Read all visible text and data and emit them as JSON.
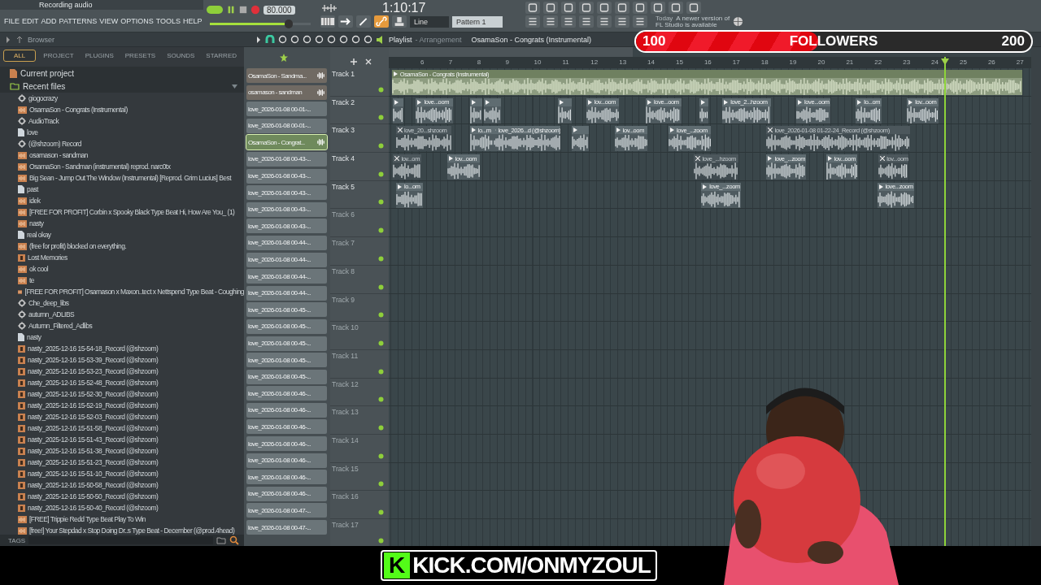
{
  "top_bar": {
    "hint": "Recording audio",
    "menu": [
      "FILE",
      "EDIT",
      "ADD",
      "PATTERNS",
      "VIEW",
      "OPTIONS",
      "TOOLS",
      "HELP"
    ],
    "tempo": "80.000",
    "time": "1:10:17",
    "master_volume": {
      "level": 0.78
    },
    "snap": "Line",
    "pattern": "Pattern 1",
    "news": {
      "date": "Today",
      "lines": [
        "A newer version of",
        "FL Studio is available"
      ]
    }
  },
  "browser": {
    "title": "Browser",
    "tabs": [
      {
        "label": "ALL",
        "selected": true
      },
      {
        "label": "PROJECT",
        "selected": false
      },
      {
        "label": "PLUGINS",
        "selected": false
      },
      {
        "label": "PRESETS",
        "selected": false
      },
      {
        "label": "SOUNDS",
        "selected": false
      },
      {
        "label": "STARRED",
        "selected": false
      }
    ],
    "tree": [
      {
        "label": "Current project",
        "kind": "project",
        "expanded": false
      },
      {
        "label": "Recent files",
        "kind": "recent",
        "expanded": true,
        "children": [
          {
            "label": "giogocrazy",
            "kind": "plugin"
          },
          {
            "label": "OsamaSon - Congrats (Instrumental)",
            "kind": "audio"
          },
          {
            "label": "AudioTrack",
            "kind": "plugin"
          },
          {
            "label": "love",
            "kind": "file"
          },
          {
            "label": "(@shzoom) Record",
            "kind": "plugin"
          },
          {
            "label": "osamason - sandman",
            "kind": "audio"
          },
          {
            "label": "OsamaSon - Sandman (instrumental) reprod. narc0tx",
            "kind": "audio"
          },
          {
            "label": "Big Sean - Jump Out The Window (Instrumental) [Reprod. Grim Lucius] Best",
            "kind": "audio"
          },
          {
            "label": "past",
            "kind": "file"
          },
          {
            "label": "idek",
            "kind": "audio"
          },
          {
            "label": "[FREE FOR PROFIT] Corbin x Spooky Black Type Beat Hi, How Are You_ (1)",
            "kind": "audio"
          },
          {
            "label": "nasty",
            "kind": "audio"
          },
          {
            "label": "real okay",
            "kind": "file"
          },
          {
            "label": "(free for profit) blocked on everything.",
            "kind": "audio"
          },
          {
            "label": "Lost Memories",
            "kind": "recording"
          },
          {
            "label": "ok cool",
            "kind": "audio"
          },
          {
            "label": "te",
            "kind": "audio"
          },
          {
            "label": "[FREE FOR PROFIT] Osamason x Maxon..tect x Nettspend Type Beat - Coughing",
            "kind": "audio"
          },
          {
            "label": "Che_deep_libs",
            "kind": "plugin"
          },
          {
            "label": "autumn_ADLIBS",
            "kind": "plugin"
          },
          {
            "label": "Autumn_Filtered_Adlibs",
            "kind": "plugin"
          },
          {
            "label": "nasty",
            "kind": "file"
          },
          {
            "label": "nasty_2025-12-16 15-54-18_Record (@shzoom)",
            "kind": "recording"
          },
          {
            "label": "nasty_2025-12-16 15-53-39_Record (@shzoom)",
            "kind": "recording"
          },
          {
            "label": "nasty_2025-12-16 15-53-23_Record (@shzoom)",
            "kind": "recording"
          },
          {
            "label": "nasty_2025-12-16 15-52-48_Record (@shzoom)",
            "kind": "recording"
          },
          {
            "label": "nasty_2025-12-16 15-52-30_Record (@shzoom)",
            "kind": "recording"
          },
          {
            "label": "nasty_2025-12-16 15-52-19_Record (@shzoom)",
            "kind": "recording"
          },
          {
            "label": "nasty_2025-12-16 15-52-03_Record (@shzoom)",
            "kind": "recording"
          },
          {
            "label": "nasty_2025-12-16 15-51-58_Record (@shzoom)",
            "kind": "recording"
          },
          {
            "label": "nasty_2025-12-16 15-51-43_Record (@shzoom)",
            "kind": "recording"
          },
          {
            "label": "nasty_2025-12-16 15-51-38_Record (@shzoom)",
            "kind": "recording"
          },
          {
            "label": "nasty_2025-12-16 15-51-23_Record (@shzoom)",
            "kind": "recording"
          },
          {
            "label": "nasty_2025-12-16 15-51-10_Record (@shzoom)",
            "kind": "recording"
          },
          {
            "label": "nasty_2025-12-16 15-50-58_Record (@shzoom)",
            "kind": "recording"
          },
          {
            "label": "nasty_2025-12-16 15-50-50_Record (@shzoom)",
            "kind": "recording"
          },
          {
            "label": "nasty_2025-12-16 15-50-40_Record (@shzoom)",
            "kind": "recording"
          },
          {
            "label": "[FREE] Trippie Redd Type Beat Play To Win",
            "kind": "audio"
          },
          {
            "label": "[free!] Your Stepdad x Stop Doing Dr..s Type Beat - December (@prod.4head)",
            "kind": "audio"
          }
        ]
      }
    ],
    "tags_label": "TAGS"
  },
  "playlist": {
    "title": "Playlist",
    "subtitle": "- Arrangement",
    "arrangement": "OsamaSon - Congrats (Instrumental)",
    "clip_list": [
      {
        "label": "OsamaSon - Sandma...",
        "kind": "audio",
        "selected": false
      },
      {
        "label": "osamason - sandman",
        "kind": "audio",
        "selected": false
      },
      {
        "label": "love_2026-01-08 00-01-...",
        "kind": "clip",
        "selected": false
      },
      {
        "label": "love_2026-01-08 00-01-...",
        "kind": "clip",
        "selected": false
      },
      {
        "label": "OsamaSon - Congrat...",
        "kind": "audio",
        "selected": true
      },
      {
        "label": "love_2026-01-08 00-43-...",
        "kind": "clip",
        "selected": false
      },
      {
        "label": "love_2026-01-08 00-43-...",
        "kind": "clip",
        "selected": false
      },
      {
        "label": "love_2026-01-08 00-43-...",
        "kind": "clip",
        "selected": false
      },
      {
        "label": "love_2026-01-08 00-43-...",
        "kind": "clip",
        "selected": false
      },
      {
        "label": "love_2026-01-08 00-43-...",
        "kind": "clip",
        "selected": false
      },
      {
        "label": "love_2026-01-08 00-44-...",
        "kind": "clip",
        "selected": false
      },
      {
        "label": "love_2026-01-08 00-44-...",
        "kind": "clip",
        "selected": false
      },
      {
        "label": "love_2026-01-08 00-44-...",
        "kind": "clip",
        "selected": false
      },
      {
        "label": "love_2026-01-08 00-44-...",
        "kind": "clip",
        "selected": false
      },
      {
        "label": "love_2026-01-08 00-45-...",
        "kind": "clip",
        "selected": false
      },
      {
        "label": "love_2026-01-08 00-45-...",
        "kind": "clip",
        "selected": false
      },
      {
        "label": "love_2026-01-08 00-45-...",
        "kind": "clip",
        "selected": false
      },
      {
        "label": "love_2026-01-08 00-45-...",
        "kind": "clip",
        "selected": false
      },
      {
        "label": "love_2026-01-08 00-45-...",
        "kind": "clip",
        "selected": false
      },
      {
        "label": "love_2026-01-08 00-46-...",
        "kind": "clip",
        "selected": false
      },
      {
        "label": "love_2026-01-08 00-46-...",
        "kind": "clip",
        "selected": false
      },
      {
        "label": "love_2026-01-08 00-46-...",
        "kind": "clip",
        "selected": false
      },
      {
        "label": "love_2026-01-08 00-46-...",
        "kind": "clip",
        "selected": false
      },
      {
        "label": "love_2026-01-08 00-46-...",
        "kind": "clip",
        "selected": false
      },
      {
        "label": "love_2026-01-08 00-46-...",
        "kind": "clip",
        "selected": false
      },
      {
        "label": "love_2026-01-08 00-46-...",
        "kind": "clip",
        "selected": false
      },
      {
        "label": "love_2026-01-08 00-47-...",
        "kind": "clip",
        "selected": false
      },
      {
        "label": "love_2026-01-08 00-47-...",
        "kind": "clip",
        "selected": false
      }
    ],
    "ruler": [
      "6",
      "7",
      "8",
      "9",
      "10",
      "11",
      "12",
      "13",
      "14",
      "15",
      "16",
      "17",
      "18",
      "19",
      "20",
      "21",
      "22",
      "23",
      "24",
      "25",
      "26",
      "27"
    ],
    "playhead": {
      "level": 0.864
    },
    "tracks": [
      {
        "name": "Track 1",
        "greyed": false,
        "clips": [
          {
            "label": "OsamaSon - Congrats (Instrumental)",
            "muted": false,
            "kind": "main"
          }
        ]
      },
      {
        "name": "Track 2",
        "greyed": false,
        "clips": [
          {
            "muted": false
          },
          {
            "label": "love...oom",
            "muted": false
          },
          {
            "muted": false
          },
          {
            "muted": false
          },
          {
            "muted": false
          },
          {
            "label": "lov...oom",
            "muted": false
          },
          {
            "label": "love...oom",
            "muted": false
          },
          {
            "muted": false
          },
          {
            "label": "love_2...hzoom",
            "muted": false
          },
          {
            "label": "love...oom",
            "muted": false
          },
          {
            "label": "lo...om",
            "muted": false
          },
          {
            "label": "lov...oom",
            "muted": false
          }
        ]
      },
      {
        "name": "Track 3",
        "greyed": false,
        "clips": [
          {
            "label": "love_20...shzoom",
            "muted": true
          },
          {
            "label": "lo...m",
            "muted": false
          },
          {
            "label": "love_2026...d (@shzoom)",
            "muted": false
          },
          {
            "muted": false
          },
          {
            "label": "lov...oom",
            "muted": false
          },
          {
            "label": "love_...zoom",
            "muted": false
          },
          {
            "label": "love_2026-01-08 01-22-24_Record (@shzoom)",
            "muted": true
          }
        ]
      },
      {
        "name": "Track 4",
        "greyed": false,
        "clips": [
          {
            "label": "lov...om",
            "muted": true
          },
          {
            "label": "lov...oom",
            "muted": false
          },
          {
            "label": "love_...hzoom",
            "muted": true
          },
          {
            "label": "love_...zoom",
            "muted": false
          },
          {
            "label": "lov...oom",
            "muted": false
          },
          {
            "label": "lov...oom",
            "muted": true
          }
        ]
      },
      {
        "name": "Track 5",
        "greyed": false,
        "clips": [
          {
            "label": "lo...om",
            "muted": false
          },
          {
            "label": "love_...zoom",
            "muted": false
          },
          {
            "label": "love...zoom",
            "muted": false
          }
        ]
      },
      {
        "name": "Track 6",
        "greyed": true
      },
      {
        "name": "Track 7",
        "greyed": true
      },
      {
        "name": "Track 8",
        "greyed": true
      },
      {
        "name": "Track 9",
        "greyed": true
      },
      {
        "name": "Track 10",
        "greyed": true
      },
      {
        "name": "Track 11",
        "greyed": true
      },
      {
        "name": "Track 12",
        "greyed": true
      },
      {
        "name": "Track 13",
        "greyed": true
      },
      {
        "name": "Track 14",
        "greyed": true
      },
      {
        "name": "Track 15",
        "greyed": true
      },
      {
        "name": "Track 16",
        "greyed": true
      },
      {
        "name": "Track 17",
        "greyed": true
      }
    ]
  },
  "followers_goal": {
    "start": "100",
    "label": "FOLLOWERS",
    "goal": "200",
    "level": 0.46
  },
  "stream_banner": {
    "logo_letter": "K",
    "text": "KICK.COM/ONMYZOUL"
  }
}
